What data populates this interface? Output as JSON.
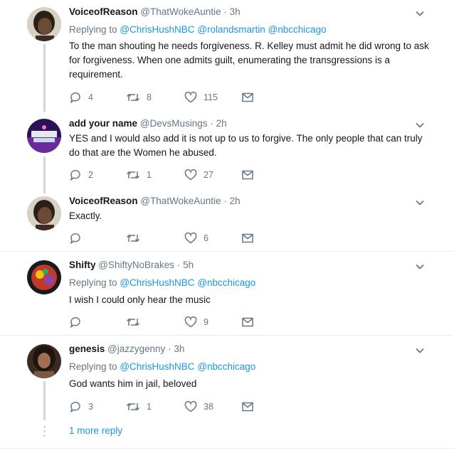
{
  "tweets": [
    {
      "name": "VoiceofReason",
      "handle": "@ThatWokeAuntie",
      "dot": "·",
      "time": "3h",
      "replying_label": "Replying to",
      "mentions": [
        "@ChrisHushNBC",
        "@rolandsmartin",
        "@nbcchicago"
      ],
      "text": "To the man shouting he needs forgiveness.  R. Kelley must admit he did wrong to ask for forgiveness.  When one admits guilt, enumerating the transgressions is a requirement.",
      "replies": "4",
      "retweets": "8",
      "likes": "115",
      "avatar_bg": "#4a3a2e"
    },
    {
      "name": "add your name",
      "handle": "@DevsMusings",
      "dot": "·",
      "time": "2h",
      "text": "YES and I would also add it is not up to us to forgive. The only people that can truly do that are the Women he abused.",
      "replies": "2",
      "retweets": "1",
      "likes": "27",
      "avatar_bg": "#3a1a6e"
    },
    {
      "name": "VoiceofReason",
      "handle": "@ThatWokeAuntie",
      "dot": "·",
      "time": "2h",
      "text": "Exactly.",
      "replies": "",
      "retweets": "",
      "likes": "6",
      "avatar_bg": "#4a3a2e"
    },
    {
      "name": "Shifty",
      "handle": "@ShiftyNoBrakes",
      "dot": "·",
      "time": "5h",
      "replying_label": "Replying to",
      "mentions": [
        "@ChrisHushNBC",
        "@nbcchicago"
      ],
      "text": "I wish I could only hear the music",
      "replies": "",
      "retweets": "",
      "likes": "9",
      "avatar_bg": "#b0342a"
    },
    {
      "name": "genesis",
      "handle": "@jazzygenny",
      "dot": "·",
      "time": "3h",
      "replying_label": "Replying to",
      "mentions": [
        "@ChrisHushNBC",
        "@nbcchicago"
      ],
      "text": "God wants him in jail, beloved",
      "replies": "3",
      "retweets": "1",
      "likes": "38",
      "avatar_bg": "#5a3a2a"
    }
  ],
  "more_replies": "1 more reply",
  "colors": {
    "link": "#1b95e0",
    "muted": "#657786",
    "thread": "#ccd6dd"
  }
}
